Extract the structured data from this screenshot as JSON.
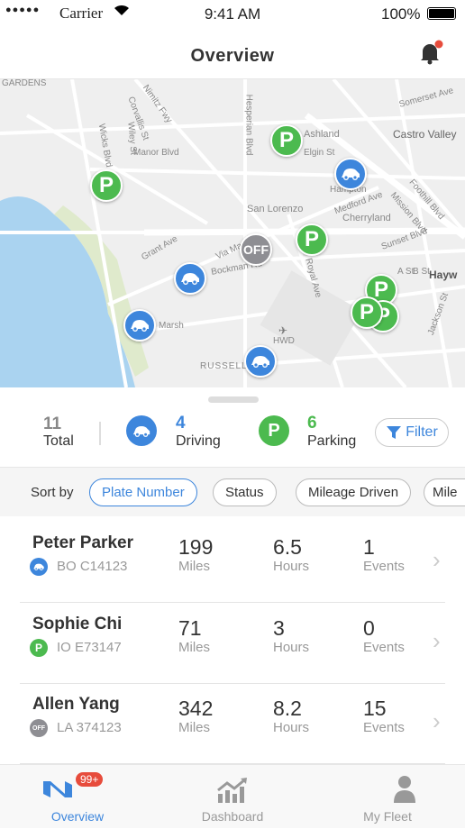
{
  "status_bar": {
    "carrier": "Carrier",
    "time": "9:41 AM",
    "battery": "100%"
  },
  "header": {
    "title": "Overview",
    "notification_icon": "bell-icon",
    "has_unread": true
  },
  "map": {
    "labels": [
      "GARDENS",
      "Nimitz Fwy",
      "Corvallis St",
      "Wiley St",
      "Wicks Blvd",
      "Manor Blvd",
      "Hesperian Blvd",
      "Ashland",
      "Elgin St",
      "Castro Valley",
      "Somerset Ave",
      "San Lorenzo",
      "Hampton",
      "Medford Ave",
      "Cherryland",
      "Foothill Blvd",
      "Mission Blvd",
      "Grant Ave",
      "Via Manos",
      "Bockman Rd",
      "Royal Ave",
      "Sunset Blvd",
      "A St",
      "B St",
      "Hayw",
      "Marsh",
      "HWD",
      "RUSSELL C",
      "Jackson St"
    ],
    "markers": [
      {
        "type": "parking",
        "label": "P"
      },
      {
        "type": "parking",
        "label": "P"
      },
      {
        "type": "driving"
      },
      {
        "type": "off",
        "label": "OFF"
      },
      {
        "type": "parking",
        "label": "P"
      },
      {
        "type": "driving"
      },
      {
        "type": "driving"
      },
      {
        "type": "driving"
      },
      {
        "type": "parking",
        "label": "P"
      },
      {
        "type": "parking",
        "label": "P"
      },
      {
        "type": "parking",
        "label": "P"
      }
    ]
  },
  "summary": {
    "total": "11",
    "total_label": "Total",
    "driving": "4",
    "driving_label": "Driving",
    "parking": "6",
    "parking_label": "Parking",
    "filter_label": "Filter"
  },
  "sort": {
    "label": "Sort by",
    "options": [
      "Plate Number",
      "Status",
      "Mileage Driven",
      "Mile"
    ],
    "selected": "Plate Number"
  },
  "vehicles": [
    {
      "name": "Peter Parker",
      "status": "driving",
      "plate": "BO C14123",
      "miles": "199",
      "hours": "6.5",
      "events": "1"
    },
    {
      "name": "Sophie Chi",
      "status": "parking",
      "plate": "IO E73147",
      "miles": "71",
      "hours": "3",
      "events": "0"
    },
    {
      "name": "Allen Yang",
      "status": "off",
      "plate": "LA 374123",
      "miles": "342",
      "hours": "8.2",
      "events": "15"
    }
  ],
  "units": {
    "miles": "Miles",
    "hours": "Hours",
    "events": "Events"
  },
  "tabs": [
    {
      "label": "Overview",
      "badge": "99+",
      "active": true
    },
    {
      "label": "Dashboard"
    },
    {
      "label": "My Fleet"
    }
  ],
  "colors": {
    "accent": "#3d86dc",
    "parking": "#4cba4f",
    "off": "#8e8e93",
    "badge": "#e74c3c",
    "water": "#aad3f0"
  }
}
